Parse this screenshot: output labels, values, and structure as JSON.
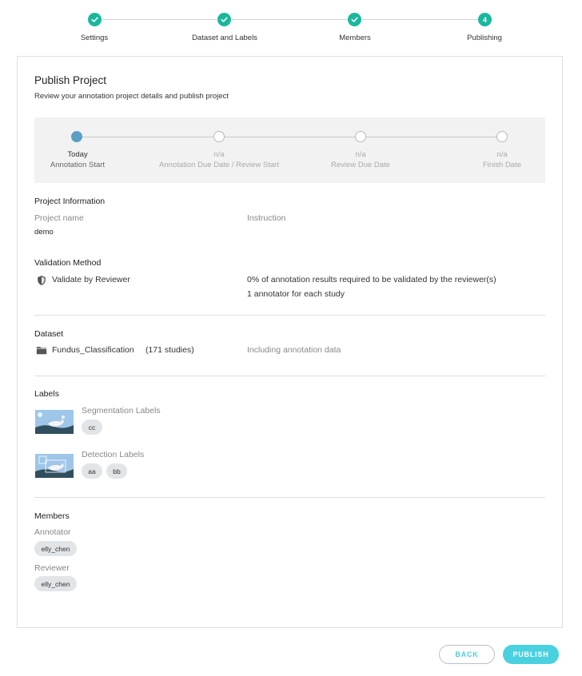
{
  "stepper": {
    "steps": [
      {
        "label": "Settings",
        "state": "done",
        "icon": "check-icon"
      },
      {
        "label": "Dataset and Labels",
        "state": "done",
        "icon": "check-icon"
      },
      {
        "label": "Members",
        "state": "done",
        "icon": "check-icon"
      },
      {
        "label": "Publishing",
        "state": "current",
        "number": "4"
      }
    ]
  },
  "page": {
    "title": "Publish Project",
    "subtitle": "Review your annotation project details and publish project"
  },
  "timeline": {
    "points": [
      {
        "value": "Today",
        "label": "Annotation Start",
        "active": true
      },
      {
        "value": "n/a",
        "label": "Annotation Due Date / Review Start",
        "active": false
      },
      {
        "value": "n/a",
        "label": "Review Due Date",
        "active": false
      },
      {
        "value": "n/a",
        "label": "Finish Date",
        "active": false
      }
    ]
  },
  "project_info": {
    "title": "Project Information",
    "name_label": "Project name",
    "name_value": "demo",
    "instruction_label": "Instruction"
  },
  "validation": {
    "title": "Validation Method",
    "icon": "shield-icon",
    "method": "Validate by Reviewer",
    "required": "0% of annotation results required to be validated by the reviewer(s)",
    "annotators": "1 annotator for each study"
  },
  "dataset": {
    "title": "Dataset",
    "icon": "folder-icon",
    "name": "Fundus_Classification",
    "count": "(171 studies)",
    "note": "Including annotation data"
  },
  "labels": {
    "title": "Labels",
    "segmentation_label": "Segmentation Labels",
    "segmentation_chips": [
      "cc"
    ],
    "detection_label": "Detection Labels",
    "detection_chips": [
      "aa",
      "bb"
    ]
  },
  "members": {
    "title": "Members",
    "annotator_label": "Annotator",
    "annotator": "elly_chen",
    "reviewer_label": "Reviewer",
    "reviewer": "elly_chen"
  },
  "actions": {
    "back": "BACK",
    "publish": "PUBLISH"
  },
  "colors": {
    "step_done": "#19b89c",
    "timeline_active": "#5b9fc5",
    "accent": "#49d1e0"
  }
}
